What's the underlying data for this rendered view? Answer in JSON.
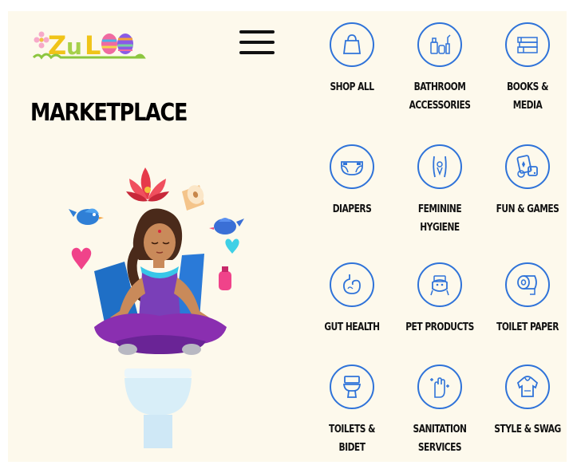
{
  "header": {
    "logo_text": "ZULOO",
    "menu_icon": "hamburger-icon"
  },
  "page_title": "MARKETPLACE",
  "categories": [
    {
      "label_lines": [
        "SHOP ALL"
      ],
      "icon": "shopping-bag-icon"
    },
    {
      "label_lines": [
        "BATHROOM",
        "ACCESSORIES"
      ],
      "icon": "bathroom-bottles-icon"
    },
    {
      "label_lines": [
        "BOOKS &",
        "MEDIA"
      ],
      "icon": "books-icon"
    },
    {
      "label_lines": [
        "DIAPERS"
      ],
      "icon": "diaper-icon"
    },
    {
      "label_lines": [
        "FEMININE",
        "HYGIENE"
      ],
      "icon": "feminine-hygiene-icon"
    },
    {
      "label_lines": [
        "FUN & GAMES"
      ],
      "icon": "cards-dice-icon"
    },
    {
      "label_lines": [
        "GUT HEALTH"
      ],
      "icon": "stomach-icon"
    },
    {
      "label_lines": [
        "PET PRODUCTS"
      ],
      "icon": "dog-icon"
    },
    {
      "label_lines": [
        "TOILET PAPER"
      ],
      "icon": "toilet-paper-icon"
    },
    {
      "label_lines": [
        "TOILETS &",
        "BIDET"
      ],
      "icon": "toilet-icon"
    },
    {
      "label_lines": [
        "SANITATION",
        "SERVICES"
      ],
      "icon": "clean-hand-icon"
    },
    {
      "label_lines": [
        "STYLE & SWAG"
      ],
      "icon": "hoodie-icon"
    }
  ],
  "colors": {
    "background": "#fdf9ec",
    "icon_blue": "#2f73d9",
    "text": "#111111"
  }
}
